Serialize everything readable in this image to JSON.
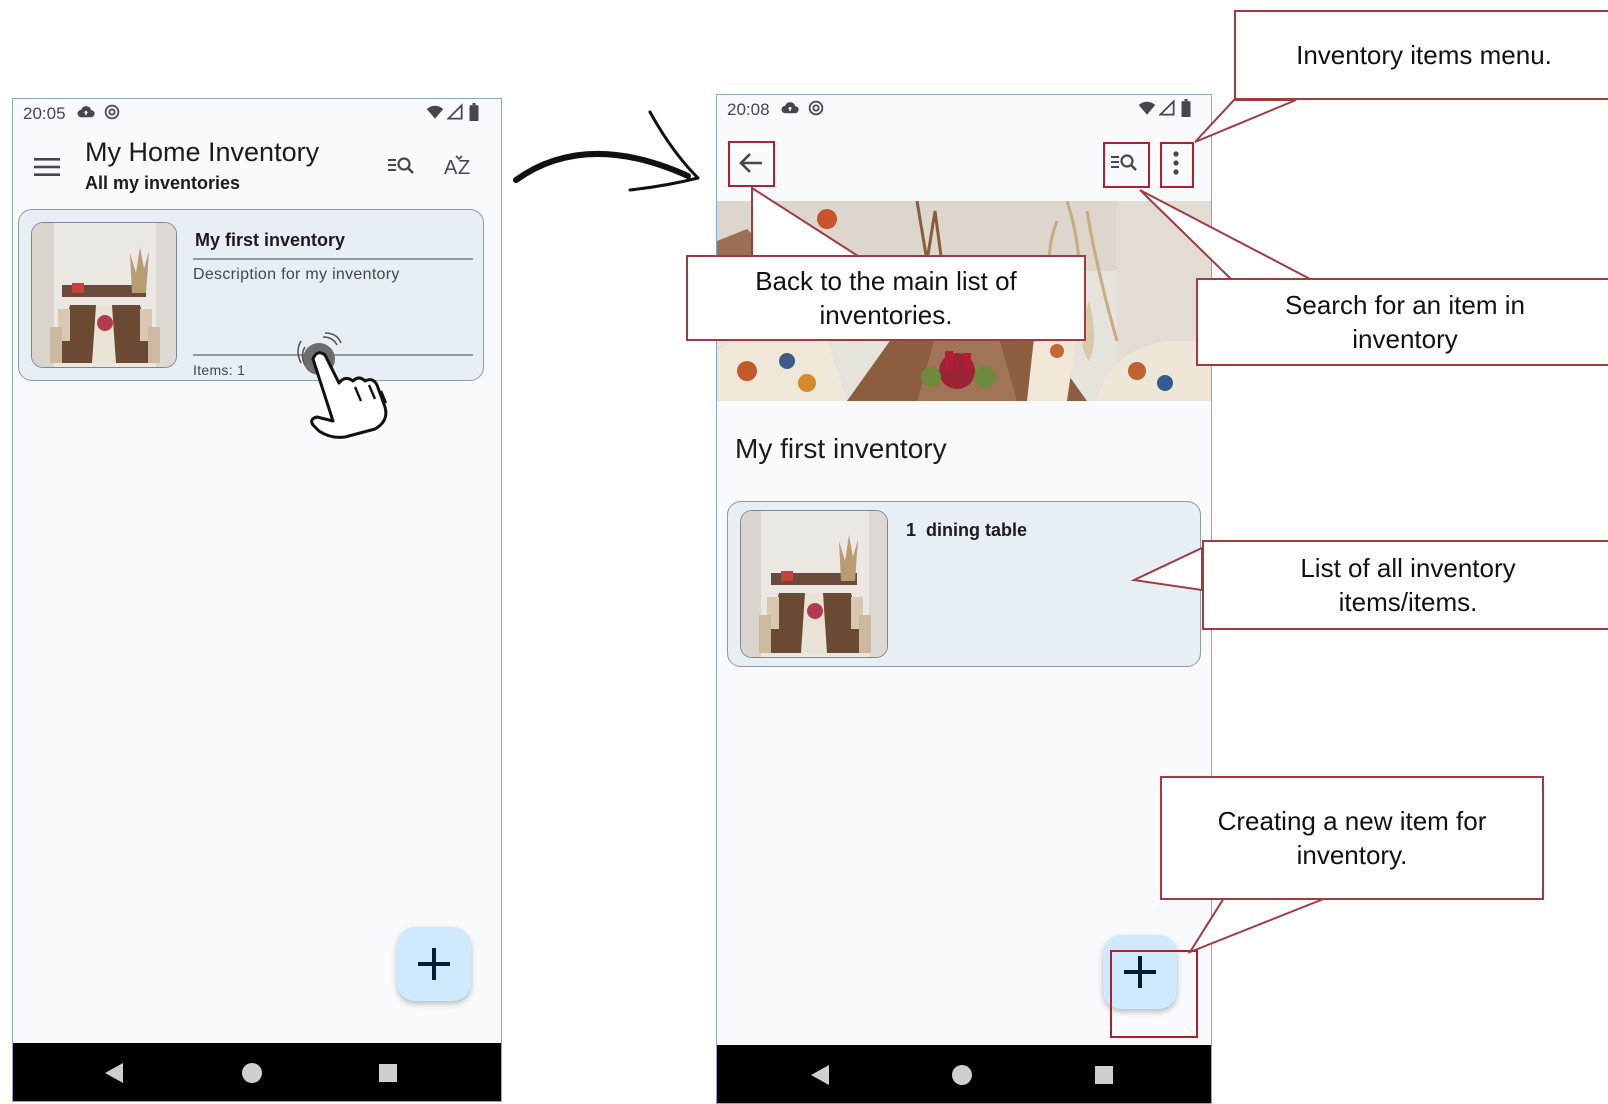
{
  "colors": {
    "screen_bg": "#f8fafd",
    "card_bg": "#e7eef4",
    "fab_bg": "#cfeafc",
    "highlight": "#b01f2e",
    "callout_border": "#a33a42",
    "nav_bar": "#000000"
  },
  "screen_main": {
    "status": {
      "time": "20:05",
      "icons": [
        "cloud-upload-icon",
        "sync-icon",
        "wifi-icon",
        "signal-icon",
        "battery-icon"
      ]
    },
    "app_bar": {
      "title": "My Home Inventory",
      "subtitle": "All my inventories",
      "icons": [
        "menu-icon",
        "search-list-icon",
        "sort-az-icon"
      ]
    },
    "inventory_card": {
      "title": "My first inventory",
      "description": "Description for my inventory",
      "count": "Items: 1"
    },
    "gesture_icon": "tap-hand-icon",
    "fab_icon": "plus-icon",
    "nav_icons": [
      "back-triangle-icon",
      "home-circle-icon",
      "recents-square-icon"
    ]
  },
  "transition_arrow_icon": "curved-arrow-icon",
  "screen_detail": {
    "status": {
      "time": "20:08",
      "icons": [
        "cloud-upload-icon",
        "sync-icon",
        "wifi-icon",
        "signal-icon",
        "battery-icon"
      ]
    },
    "top_bar_icons": [
      "arrow-back-icon",
      "search-list-icon",
      "more-vert-icon"
    ],
    "inventory_name": "My first inventory",
    "item": {
      "quantity": "1",
      "name": "dining table"
    },
    "fab_icon": "plus-icon",
    "nav_icons": [
      "back-triangle-icon",
      "home-circle-icon",
      "recents-square-icon"
    ]
  },
  "callouts": {
    "menu": "Inventory items menu.",
    "back": "Back to the main list of inventories.",
    "search": "Search for an item in inventory",
    "list": "List of all inventory items/items.",
    "create": "Creating a new item for inventory."
  }
}
